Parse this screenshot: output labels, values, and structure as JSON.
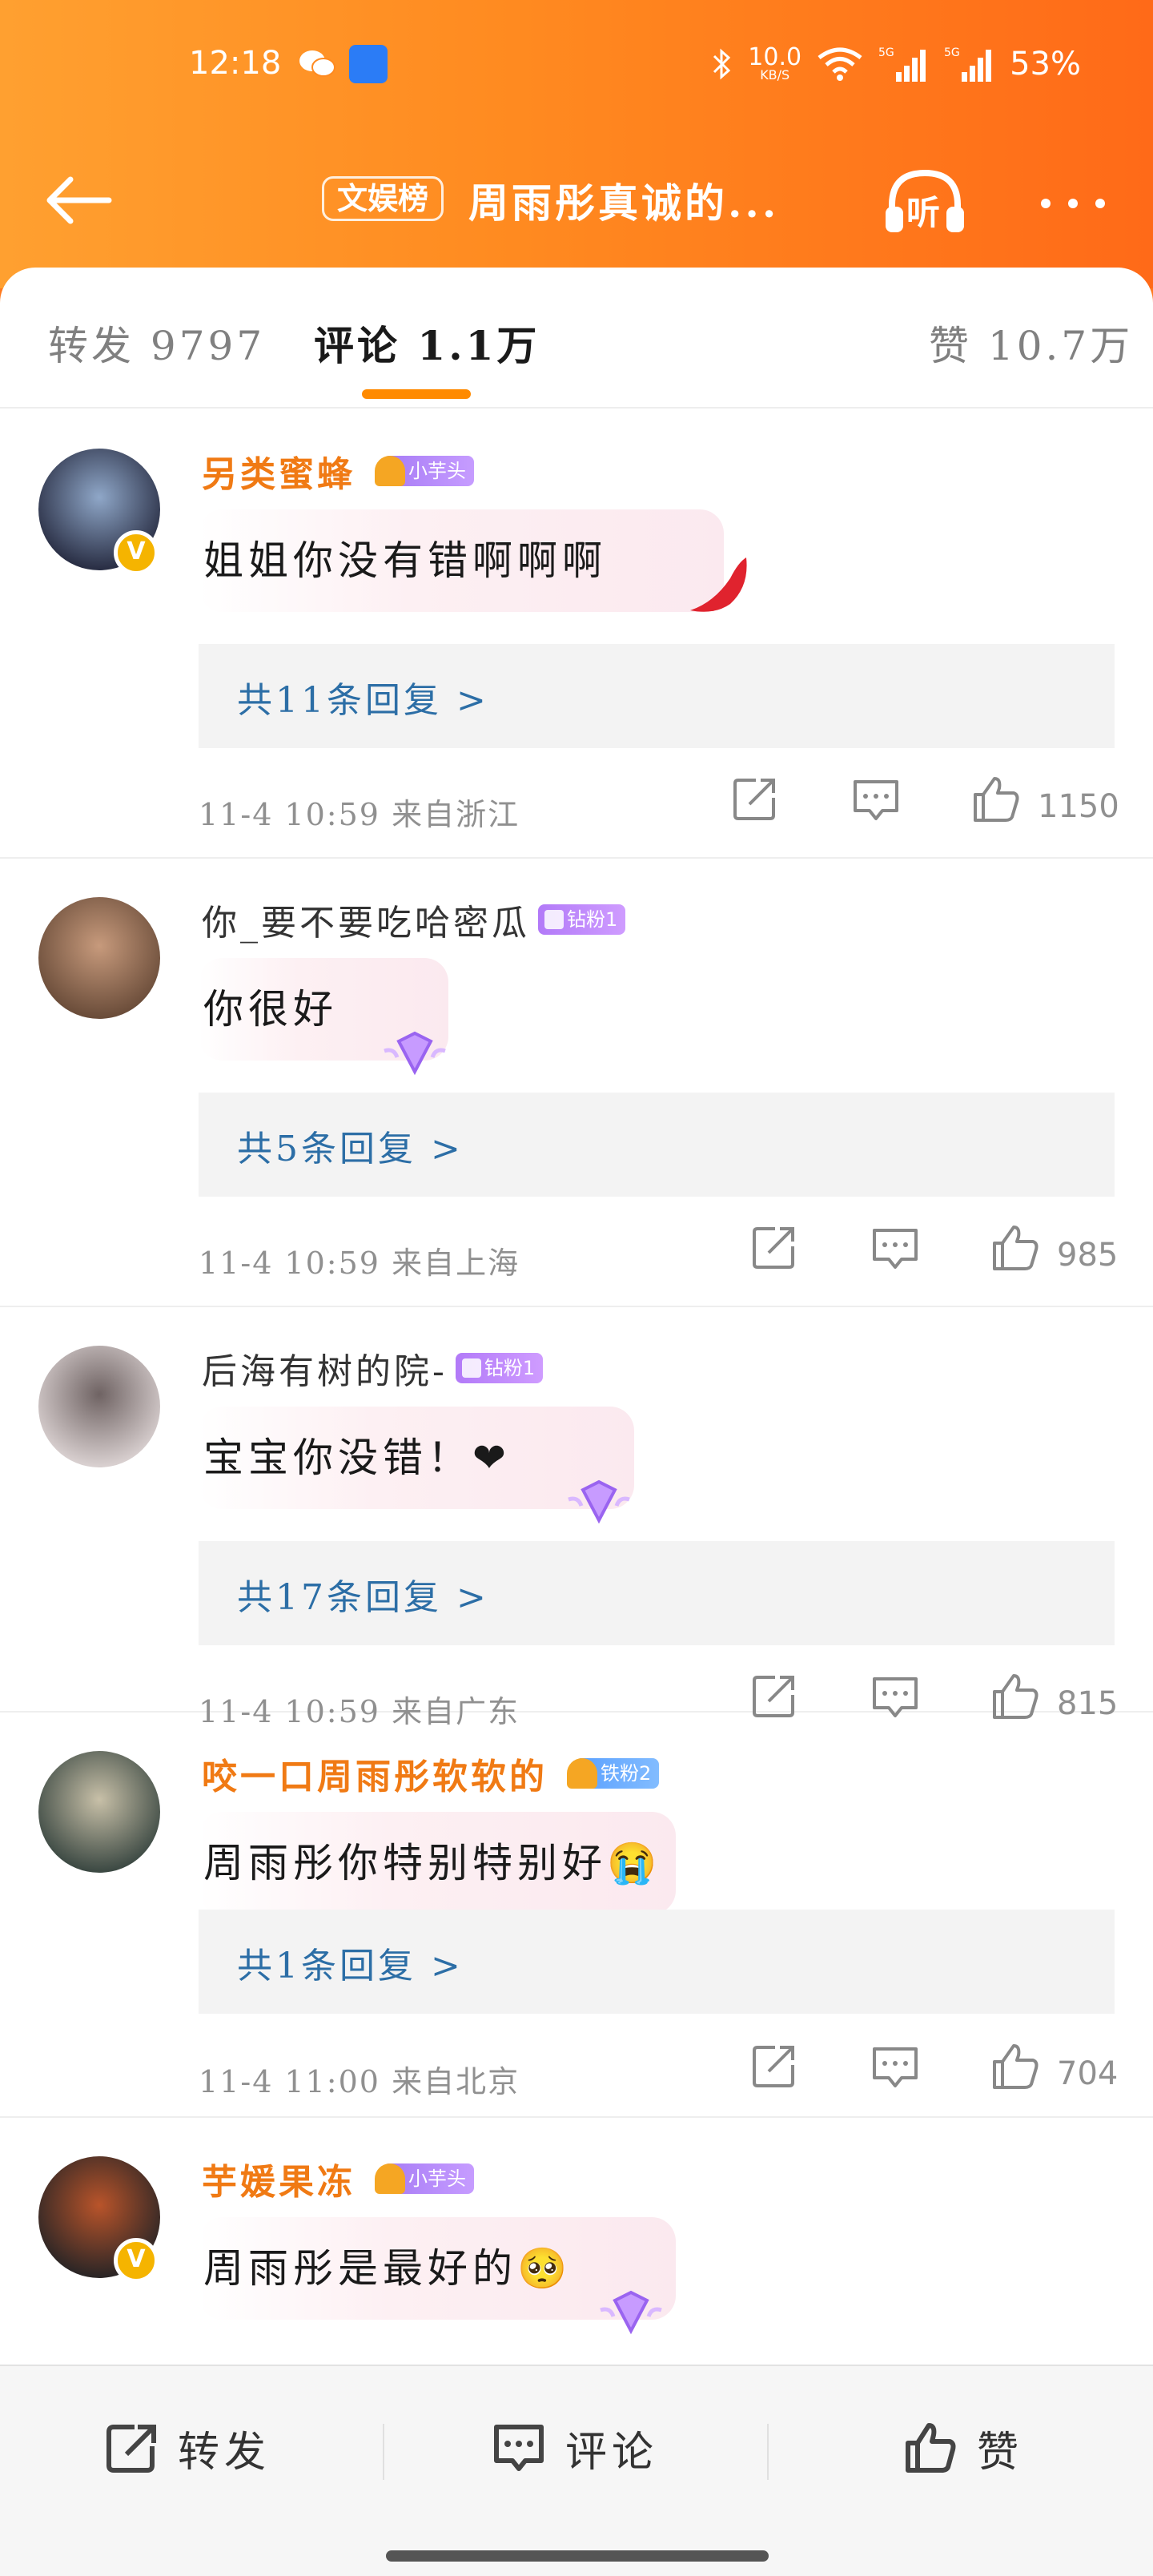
{
  "status_bar": {
    "time": "12:18",
    "net_speed_value": "10.0",
    "net_speed_unit": "KB/S",
    "battery": "53%",
    "signal_label": "5G"
  },
  "header": {
    "tag": "文娱榜",
    "title": "周雨彤真诚的...",
    "listen_label": "听",
    "back_icon": "arrow-left-icon",
    "more_icon": "more-icon"
  },
  "tabs": [
    {
      "label": "转发",
      "count": "9797"
    },
    {
      "label": "评论",
      "count": "1.1万",
      "active": true
    },
    {
      "label": "赞",
      "count": "10.7万"
    }
  ],
  "comments": [
    {
      "username": "另类蜜蜂",
      "username_color": "#f07a14",
      "badge": "小芋头",
      "badge_type": "taro",
      "verified": true,
      "text": "姐姐你没有错啊啊啊",
      "replies": "共11条回复 >",
      "time": "11-4 10:59",
      "location": "来自浙江",
      "likes": "1150",
      "avatar_colors": [
        "#2a2f45",
        "#8fa7c8"
      ]
    },
    {
      "username": "你_要不要吃哈密瓜",
      "username_color": "#333333",
      "badge": "钻粉1",
      "badge_type": "diamond",
      "verified": false,
      "text": "你很好",
      "replies": "共5条回复 >",
      "time": "11-4 10:59",
      "location": "来自上海",
      "likes": "985",
      "avatar_colors": [
        "#6b4d3a",
        "#c79a7c"
      ]
    },
    {
      "username": "后海有树的院-",
      "username_color": "#333333",
      "badge": "钻粉1",
      "badge_type": "diamond",
      "verified": false,
      "text": "宝宝你没错！❤",
      "replies": "共17条回复 >",
      "time": "11-4 10:59",
      "location": "来自广东",
      "likes": "815",
      "avatar_colors": [
        "#d8cfcf",
        "#6f6363"
      ]
    },
    {
      "username": "咬一口周雨彤软软的",
      "username_color": "#f07a14",
      "badge": "铁粉2",
      "badge_type": "iron",
      "verified": false,
      "text": "周雨彤你特别特别好😭",
      "replies": "共1条回复 >",
      "time": "11-4 11:00",
      "location": "来自北京",
      "likes": "704",
      "avatar_colors": [
        "#3d4a44",
        "#c8c0a8"
      ]
    },
    {
      "username": "芋媛果冻",
      "username_color": "#f07a14",
      "badge": "小芋头",
      "badge_type": "taro",
      "verified": true,
      "text": "周雨彤是最好的🥺",
      "avatar_colors": [
        "#2c2626",
        "#b9542a"
      ]
    }
  ],
  "bottom_bar": {
    "repost": "转发",
    "comment": "评论",
    "like": "赞"
  },
  "colors": {
    "brand_orange": "#ff8a20",
    "link_blue": "#2c6ea6",
    "tab_indicator": "#ff8a00"
  }
}
